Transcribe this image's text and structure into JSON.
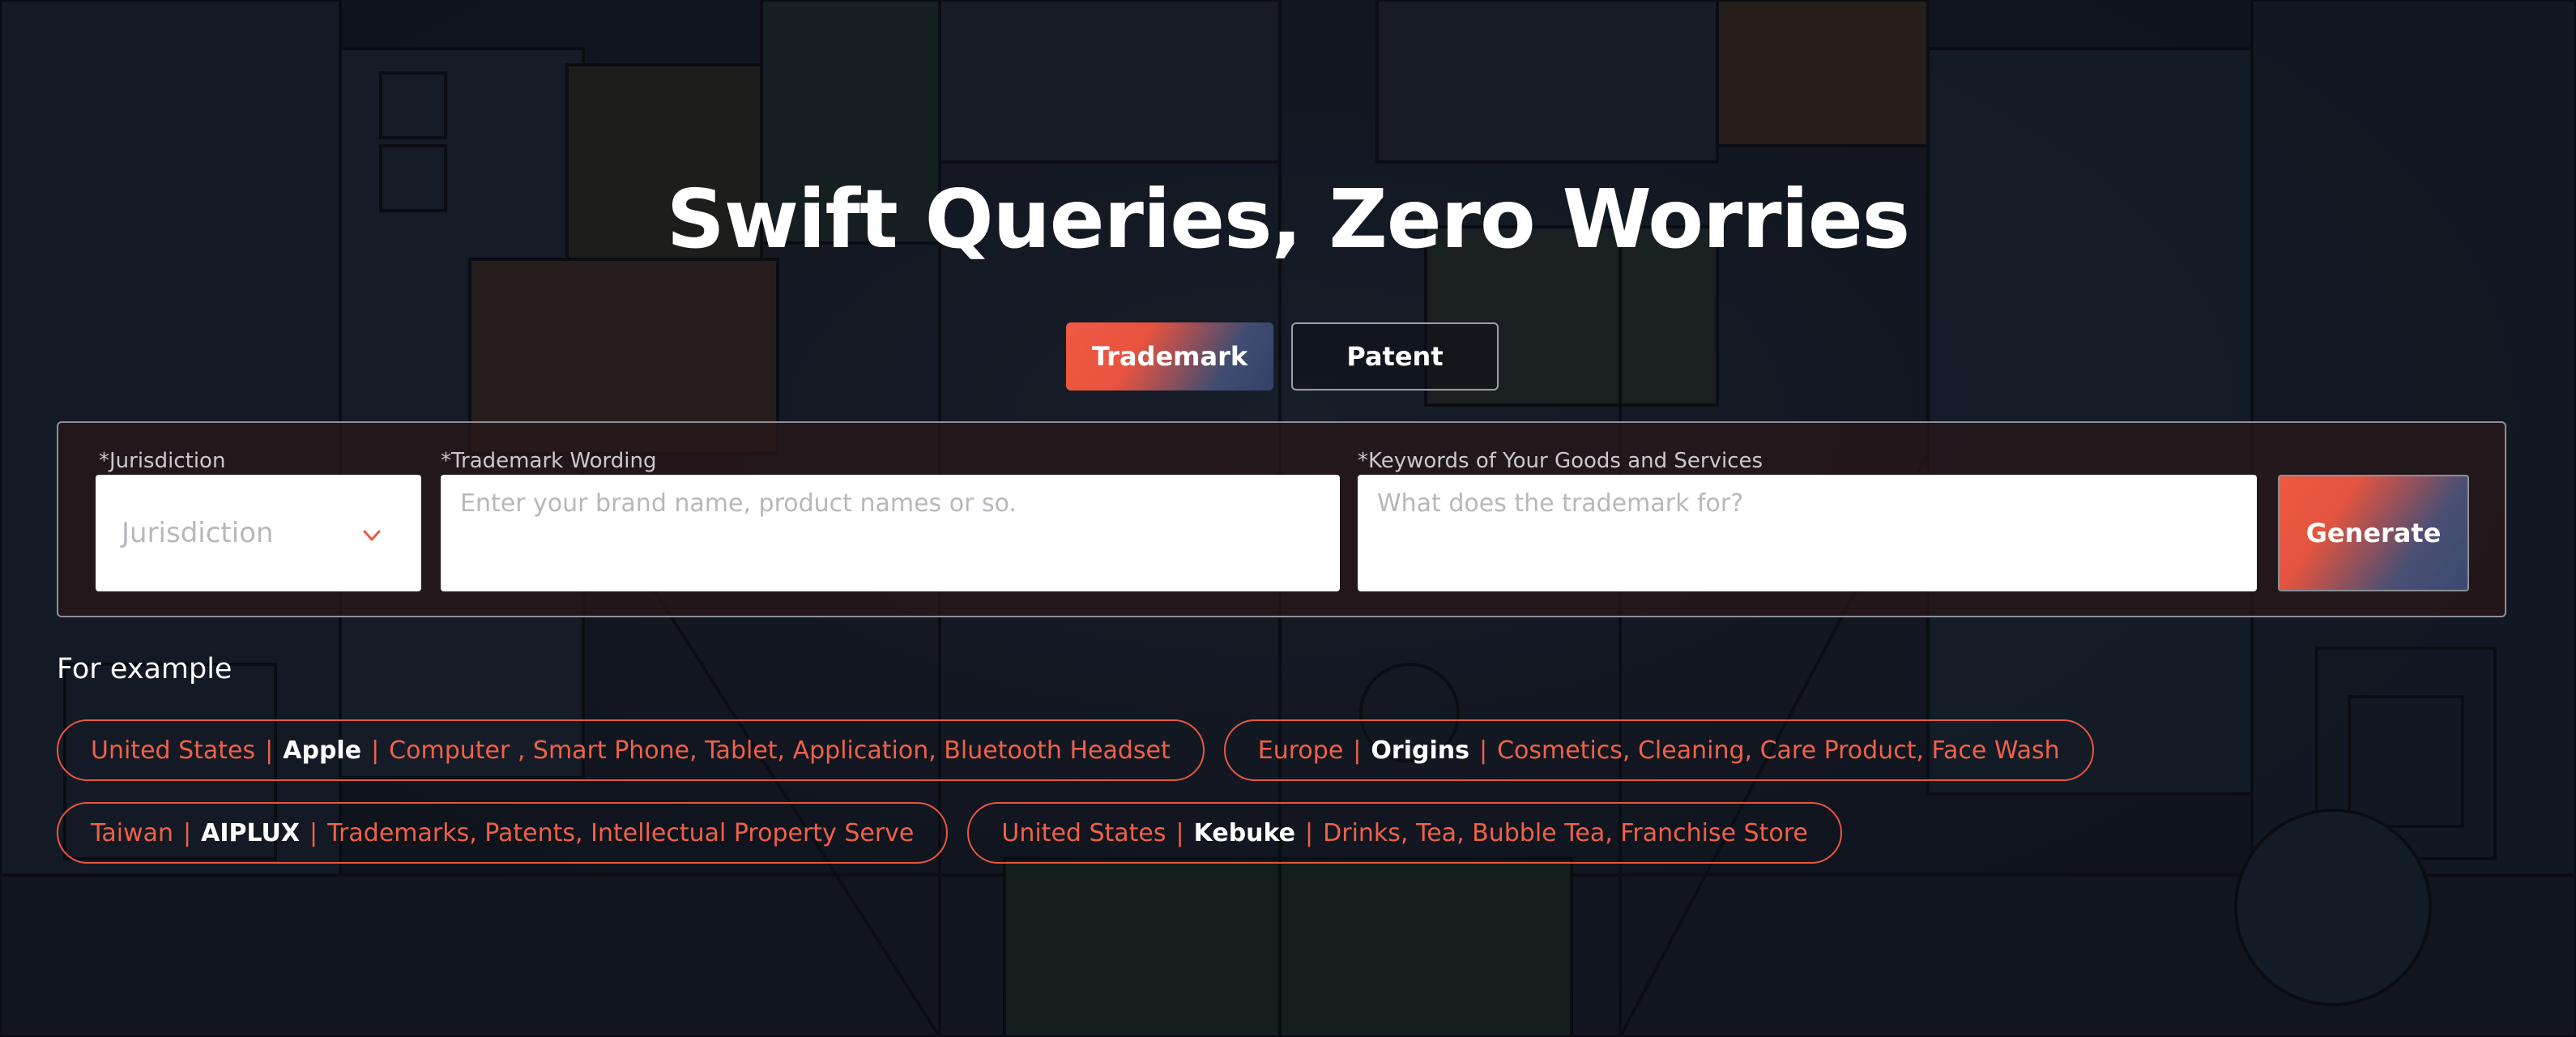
{
  "hero": {
    "title": "Swift Queries, Zero Worries"
  },
  "tabs": [
    {
      "label": "Trademark",
      "active": true
    },
    {
      "label": "Patent",
      "active": false
    }
  ],
  "form": {
    "jurisdiction_label": "*Jurisdiction",
    "jurisdiction_placeholder": "Jurisdiction",
    "wording_label": "*Trademark Wording",
    "wording_placeholder": "Enter your brand name, product names or so.",
    "keywords_label": "*Keywords of Your Goods and Services",
    "keywords_placeholder": "What does the trademark for?",
    "generate_label": "Generate"
  },
  "examples": {
    "title": "For example",
    "items": [
      {
        "region": "United States",
        "brand": "Apple",
        "goods": "Computer , Smart Phone, Tablet, Application, Bluetooth Headset"
      },
      {
        "region": "Europe",
        "brand": "Origins",
        "goods": "Cosmetics, Cleaning, Care Product, Face Wash"
      },
      {
        "region": "Taiwan",
        "brand": "AIPLUX",
        "goods": "Trademarks, Patents, Intellectual Property Serve"
      },
      {
        "region": "United States",
        "brand": "Kebuke",
        "goods": "Drinks, Tea, Bubble Tea, Franchise Store"
      }
    ]
  },
  "colors": {
    "accent": "#ee5a43",
    "navy": "#324265",
    "chip_border": "#e8573f"
  },
  "icons": {
    "dropdown": "chevron-down-icon"
  }
}
